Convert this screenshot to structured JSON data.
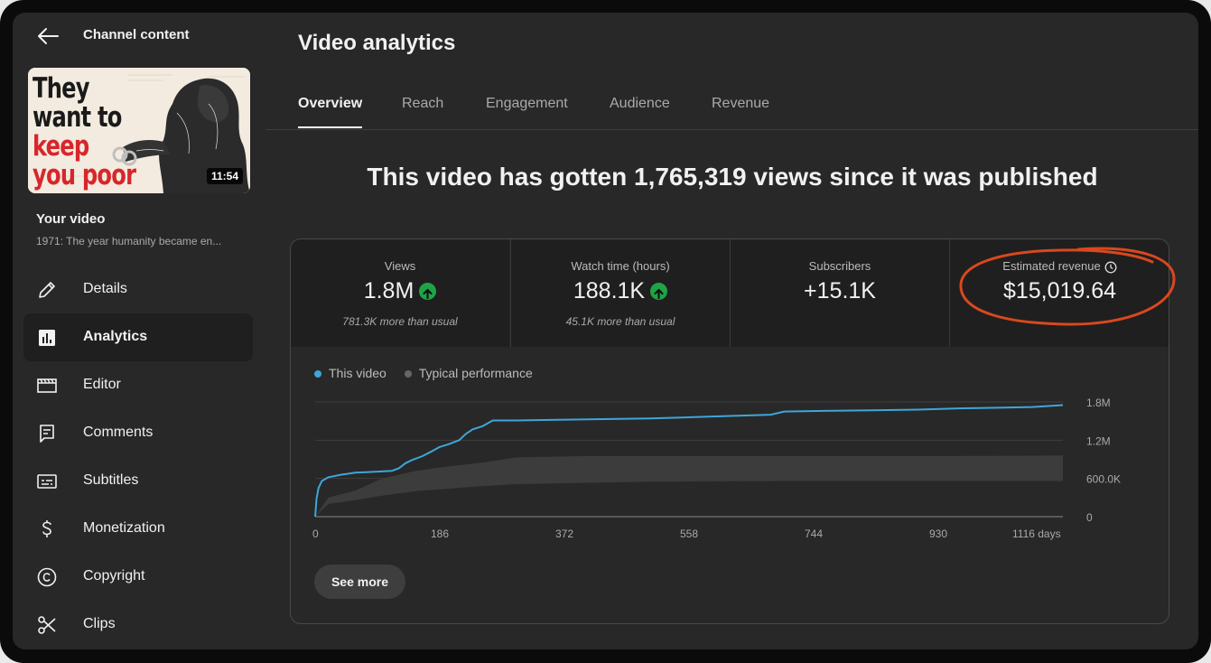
{
  "sidebar": {
    "back_label": "Channel content",
    "thumbnail": {
      "lines": [
        "They",
        "want to",
        "keep",
        "you poor"
      ],
      "duration": "11:54"
    },
    "your_video_label": "Your video",
    "video_title": "1971: The year humanity became en...",
    "items": [
      {
        "label": "Details",
        "icon": "pencil-icon",
        "active": false
      },
      {
        "label": "Analytics",
        "icon": "analytics-icon",
        "active": true
      },
      {
        "label": "Editor",
        "icon": "clapperboard-icon",
        "active": false
      },
      {
        "label": "Comments",
        "icon": "comment-icon",
        "active": false
      },
      {
        "label": "Subtitles",
        "icon": "subtitles-icon",
        "active": false
      },
      {
        "label": "Monetization",
        "icon": "dollar-icon",
        "active": false
      },
      {
        "label": "Copyright",
        "icon": "copyright-icon",
        "active": false
      },
      {
        "label": "Clips",
        "icon": "scissors-icon",
        "active": false
      }
    ]
  },
  "main": {
    "title": "Video analytics",
    "tabs": [
      {
        "label": "Overview",
        "active": true
      },
      {
        "label": "Reach",
        "active": false
      },
      {
        "label": "Engagement",
        "active": false
      },
      {
        "label": "Audience",
        "active": false
      },
      {
        "label": "Revenue",
        "active": false
      }
    ],
    "headline": "This video has gotten 1,765,319 views since it was published",
    "metrics": [
      {
        "label": "Views",
        "value": "1.8M",
        "trend": "up",
        "sub": "781.3K more than usual"
      },
      {
        "label": "Watch time (hours)",
        "value": "188.1K",
        "trend": "up",
        "sub": "45.1K more than usual"
      },
      {
        "label": "Subscribers",
        "value": "+15.1K",
        "trend": "",
        "sub": ""
      },
      {
        "label": "Estimated revenue",
        "value": "$15,019.64",
        "trend": "",
        "sub": "",
        "icon": "clock-icon"
      }
    ],
    "see_more": "See more"
  },
  "colors": {
    "this_video": "#3ea6d9",
    "typical": "#555555",
    "trend_up": "#1ea446",
    "annotation": "#d9481f"
  },
  "chart_data": {
    "type": "line",
    "legend": [
      "This video",
      "Typical performance"
    ],
    "x_ticks": [
      "0",
      "186",
      "372",
      "558",
      "744",
      "930",
      "1116 days"
    ],
    "y_ticks": [
      "0",
      "600.0K",
      "1.2M",
      "1.8M"
    ],
    "xlim": [
      0,
      1116
    ],
    "ylim": [
      0,
      1800000
    ],
    "series": [
      {
        "name": "This video",
        "x": [
          0,
          2,
          5,
          10,
          20,
          40,
          60,
          80,
          100,
          115,
          125,
          135,
          145,
          160,
          175,
          185,
          200,
          215,
          225,
          235,
          250,
          265,
          300,
          360,
          430,
          500,
          560,
          620,
          680,
          700,
          760,
          830,
          900,
          960,
          1020,
          1070,
          1100,
          1116
        ],
        "y": [
          0,
          280000,
          450000,
          560000,
          620000,
          660000,
          690000,
          700000,
          710000,
          720000,
          760000,
          840000,
          890000,
          950000,
          1030000,
          1090000,
          1140000,
          1200000,
          1300000,
          1370000,
          1420000,
          1510000,
          1510000,
          1520000,
          1530000,
          1540000,
          1560000,
          1580000,
          1600000,
          1650000,
          1660000,
          1670000,
          1680000,
          1700000,
          1710000,
          1720000,
          1740000,
          1750000
        ]
      },
      {
        "name": "Typical performance",
        "x": [
          0,
          20,
          60,
          100,
          150,
          200,
          250,
          300,
          400,
          500,
          700,
          900,
          1116
        ],
        "low": [
          0,
          200000,
          260000,
          330000,
          400000,
          440000,
          480000,
          510000,
          530000,
          550000,
          560000,
          560000,
          560000
        ],
        "high": [
          0,
          300000,
          410000,
          600000,
          720000,
          790000,
          850000,
          930000,
          950000,
          950000,
          950000,
          950000,
          960000
        ]
      }
    ]
  }
}
